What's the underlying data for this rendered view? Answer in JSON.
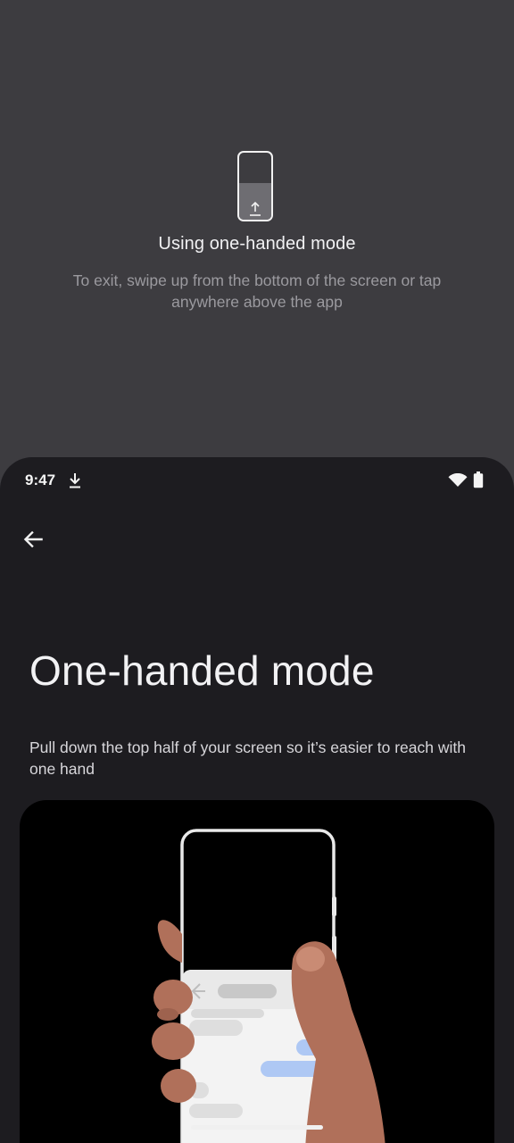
{
  "one_handed_hint": {
    "icon": "one-handed-phone-icon",
    "title": "Using one-handed mode",
    "body": "To exit, swipe up from the bottom of the screen or tap anywhere above the app"
  },
  "status_bar": {
    "time": "9:47",
    "icons": [
      "download-icon",
      "wifi-icon",
      "battery-icon"
    ]
  },
  "header": {
    "back_icon": "arrow-back-icon"
  },
  "page": {
    "title": "One-handed mode",
    "description": "Pull down the top half of your screen so it’s easier to reach with one hand",
    "illustration": "hand-holding-phone-illustration"
  },
  "colors": {
    "background": "#3d3c40",
    "app_surface": "#1d1c20",
    "illustration_bg": "#000000",
    "skin": "#b0705a",
    "accent_bubble": "#aec8f4"
  }
}
